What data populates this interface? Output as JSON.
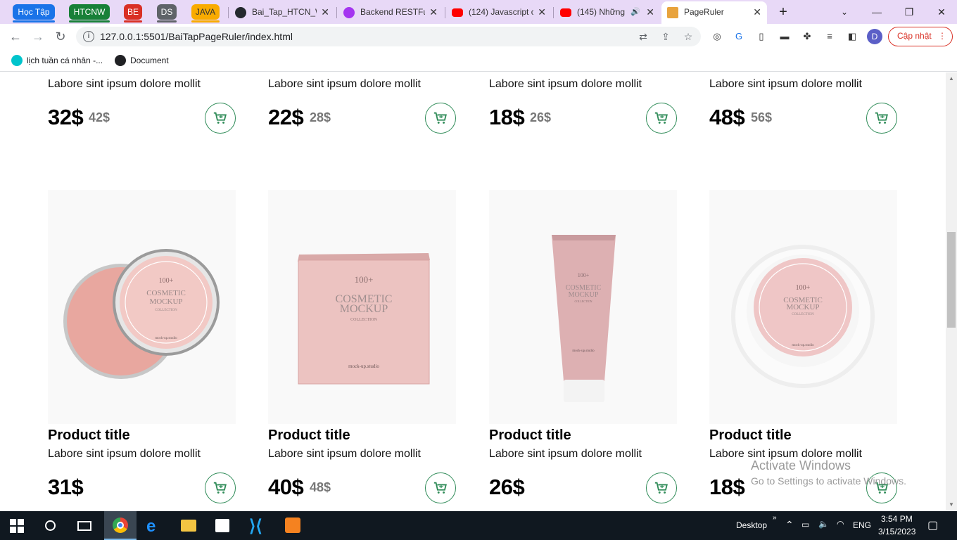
{
  "browser": {
    "tab_groups": [
      {
        "label": "Học Tập",
        "color": "#1a73e8"
      },
      {
        "label": "HTCNW",
        "color": "#188038"
      },
      {
        "label": "BE",
        "color": "#d93025"
      },
      {
        "label": "DS",
        "color": "#5f6368"
      },
      {
        "label": "JAVA",
        "color": "#f9ab00"
      }
    ],
    "tabs": [
      {
        "title": "Bai_Tap_HTCN_W",
        "icon": "github-icon",
        "icon_color": "#24292e"
      },
      {
        "title": "Backend RESTFul",
        "icon": "udemy-icon",
        "icon_color": "#a435f0"
      },
      {
        "title": "(124) Javascript c",
        "icon": "youtube-icon",
        "icon_color": "#ff0000"
      },
      {
        "title": "(145) Những",
        "icon": "youtube-icon",
        "icon_color": "#ff0000"
      },
      {
        "title": "PageRuler",
        "icon": "page-icon",
        "icon_color": "#e8a33d",
        "active": true
      }
    ],
    "new_tab_glyph": "+",
    "url": "127.0.0.1:5501/BaiTapPageRuler/index.html",
    "update_label": "Cập nhật",
    "profile_initial": "D",
    "bookmarks": [
      {
        "label": "lịch tuần cá nhân -...",
        "icon": "canva-icon"
      },
      {
        "label": "Document",
        "icon": "globe-icon"
      }
    ]
  },
  "products_top": [
    {
      "desc": "Labore sint ipsum dolore mollit",
      "price": "32$",
      "old_price": "42$"
    },
    {
      "desc": "Labore sint ipsum dolore mollit",
      "price": "22$",
      "old_price": "28$"
    },
    {
      "desc": "Labore sint ipsum dolore mollit",
      "price": "18$",
      "old_price": "26$"
    },
    {
      "desc": "Labore sint ipsum dolore mollit",
      "price": "48$",
      "old_price": "56$"
    }
  ],
  "products_bottom": [
    {
      "title": "Product title",
      "desc": "Labore sint ipsum dolore mollit",
      "price": "31$",
      "old_price": "",
      "image": "cosmetic-jar-open"
    },
    {
      "title": "Product title",
      "desc": "Labore sint ipsum dolore mollit",
      "price": "40$",
      "old_price": "48$",
      "image": "cosmetic-box"
    },
    {
      "title": "Product title",
      "desc": "Labore sint ipsum dolore mollit",
      "price": "26$",
      "old_price": "",
      "image": "cosmetic-tube"
    },
    {
      "title": "Product title",
      "desc": "Labore sint ipsum dolore mollit",
      "price": "18$",
      "old_price": "",
      "image": "cosmetic-jar-top"
    }
  ],
  "mockup_text": {
    "count": "100+",
    "line1": "COSMETIC",
    "line2": "MOCKUP",
    "line3": "COLLECTION",
    "brand": "mock-up.studio"
  },
  "watermark": {
    "line1": "Activate Windows",
    "line2": "Go to Settings to activate Windows."
  },
  "taskbar": {
    "desktop_label": "Desktop",
    "language": "ENG",
    "time": "3:54 PM",
    "date": "3/15/2023"
  },
  "colors": {
    "accent_green": "#2e8b57",
    "tab_strip": "#e8d9f7",
    "product_pink": "#e9b9b6"
  }
}
